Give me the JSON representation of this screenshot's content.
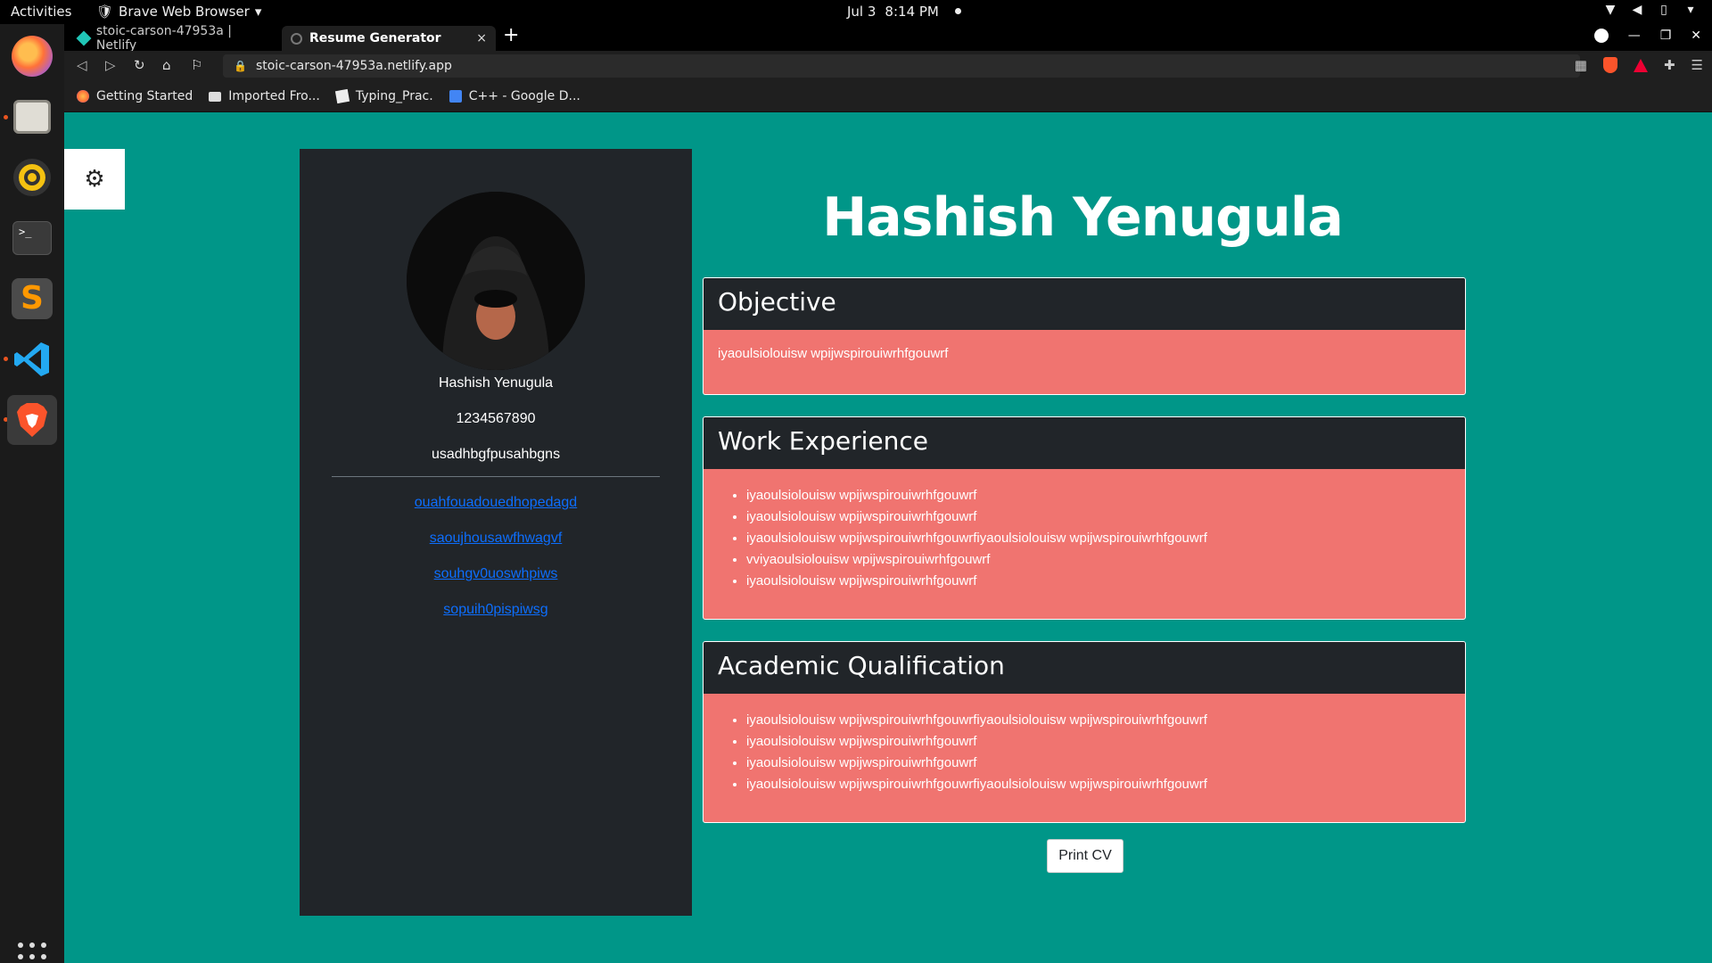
{
  "topbar": {
    "activities": "Activities",
    "app_name": "Brave Web Browser",
    "date": "Jul 3",
    "time": "8:14 PM"
  },
  "dock": {
    "apps": [
      "firefox-icon",
      "files-icon",
      "rhythmbox-icon",
      "terminal-icon",
      "sublime-text-icon",
      "vscode-icon",
      "brave-icon"
    ]
  },
  "browser": {
    "tabs": [
      {
        "title": "stoic-carson-47953a | Netlify",
        "active": false
      },
      {
        "title": "Resume Generator",
        "active": true
      }
    ],
    "tab_close": "×",
    "new_tab": "+",
    "url": "stoic-carson-47953a.netlify.app",
    "bookmarks": [
      "Getting Started",
      "Imported Fro...",
      "Typing_Prac.",
      "C++ - Google D..."
    ]
  },
  "sidebar": {
    "name": "Hashish Yenugula",
    "phone": "1234567890",
    "email": "usadhbgfpusahbgns",
    "links": [
      "ouahfouadouedhopedagd",
      "saoujhousawfhwagvf",
      "souhgv0uoswhpiws",
      "sopuih0pispiwsg"
    ]
  },
  "main": {
    "title": "Hashish Yenugula",
    "objective": {
      "header": "Objective",
      "text": "iyaoulsiolouisw wpijwspirouiwrhfgouwrf"
    },
    "work_experience": {
      "header": "Work Experience",
      "items": [
        "iyaoulsiolouisw wpijwspirouiwrhfgouwrf",
        "iyaoulsiolouisw wpijwspirouiwrhfgouwrf",
        "iyaoulsiolouisw wpijwspirouiwrhfgouwrfiyaoulsiolouisw wpijwspirouiwrhfgouwrf",
        "vviyaoulsiolouisw wpijwspirouiwrhfgouwrf",
        "iyaoulsiolouisw wpijwspirouiwrhfgouwrf"
      ]
    },
    "academic_qualification": {
      "header": "Academic Qualification",
      "items": [
        "iyaoulsiolouisw wpijwspirouiwrhfgouwrfiyaoulsiolouisw wpijwspirouiwrhfgouwrf",
        "iyaoulsiolouisw wpijwspirouiwrhfgouwrf",
        "iyaoulsiolouisw wpijwspirouiwrhfgouwrf",
        "iyaoulsiolouisw wpijwspirouiwrhfgouwrfiyaoulsiolouisw wpijwspirouiwrhfgouwrf"
      ]
    },
    "print_button": "Print CV"
  },
  "colors": {
    "page_bg": "#009688",
    "sidebar_bg": "#212529",
    "card_body_bg": "#f07470",
    "link": "#0d6efd"
  }
}
